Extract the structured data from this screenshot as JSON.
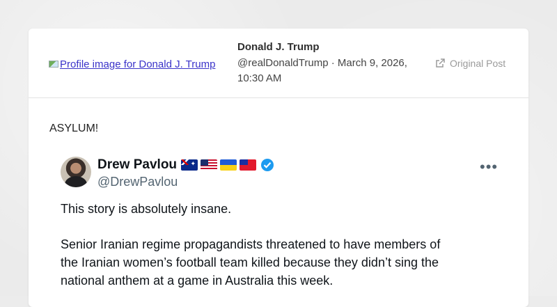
{
  "header": {
    "profile_image_alt": "Profile image for Donald J. Trump",
    "author_name": "Donald J. Trump",
    "author_meta_line1": "@realDonaldTrump · March 9, 2026,",
    "author_meta_line2": "10:30 AM",
    "original_post_label": "Original Post"
  },
  "post": {
    "text": "ASYLUM!"
  },
  "quoted_tweet": {
    "name": "Drew Pavlou",
    "flags": [
      "australia-flag",
      "usa-flag",
      "ukraine-flag",
      "taiwan-flag"
    ],
    "handle": "@DrewPavlou",
    "more_label": "•••",
    "lines": [
      "This story is absolutely insane.",
      "Senior Iranian regime propagandists threatened to have members of",
      "the Iranian women’s football team killed because they didn’t sing the",
      "national anthem at a game in Australia this week."
    ]
  },
  "colors": {
    "link": "#3a33c9",
    "verified": "#1d9bf0",
    "muted": "#9a9a9a"
  }
}
